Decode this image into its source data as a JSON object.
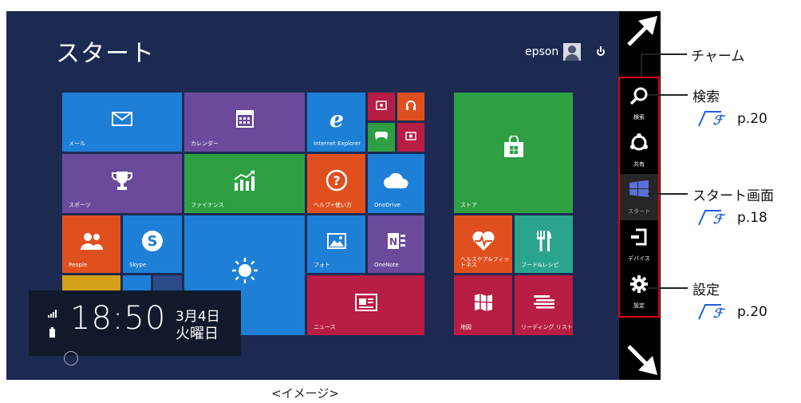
{
  "screen": {
    "title": "スタート",
    "user_name": "epson"
  },
  "tiles": {
    "mail": "メール",
    "calendar": "カレンダー",
    "ie": "Internet Explorer",
    "sports": "スポーツ",
    "finance": "ファイナンス",
    "help": "ヘルプ+使い方",
    "onedrive": "OneDrive",
    "store": "ストア",
    "people": "People",
    "skype": "Skype",
    "photos": "フォト",
    "onenote": "OneNote",
    "health": "ヘルスケア&フィットネス",
    "food": "フード&レシピ",
    "news": "ニュース",
    "maps": "地図",
    "reading": "リーディング リスト"
  },
  "lock": {
    "time": "18:50",
    "date_line1": "3月4日",
    "date_line2": "火曜日"
  },
  "charms": {
    "search": "検索",
    "share": "共有",
    "start": "スタート",
    "devices": "デバイス",
    "settings": "設定"
  },
  "callouts": {
    "charm": "チャーム",
    "search": "検索",
    "search_ref": "p.20",
    "start_screen": "スタート画面",
    "start_ref": "p.18",
    "settings": "設定",
    "settings_ref": "p.20"
  },
  "caption": "<イメージ>",
  "colors": {
    "screen_bg": "#1c2a52",
    "accent_red": "#e40012",
    "tile_blue": "#1e7fd6",
    "tile_purple": "#6b4a9c",
    "tile_green": "#2ea043",
    "tile_orange": "#e0501f",
    "tile_crimson": "#b81d43"
  }
}
